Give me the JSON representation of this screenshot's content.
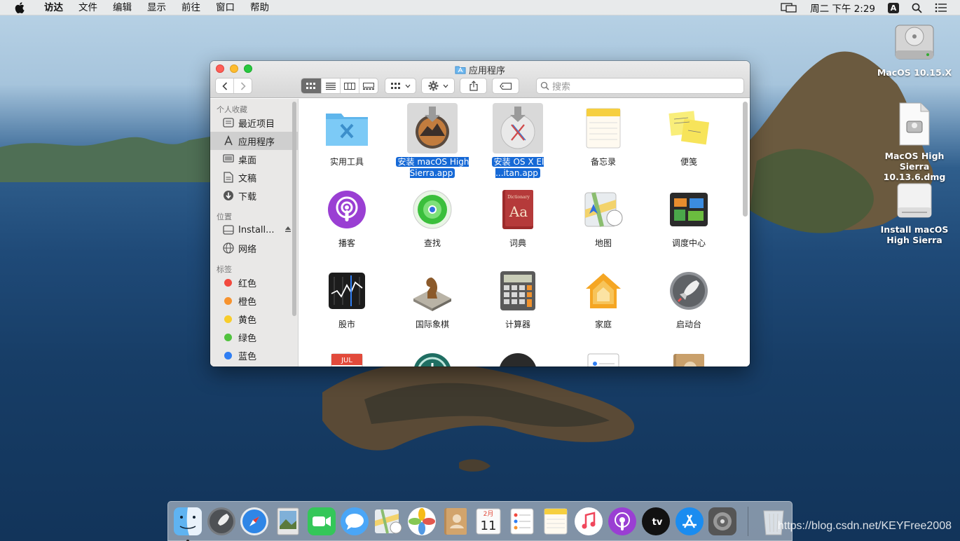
{
  "menubar": {
    "items": [
      "访达",
      "文件",
      "编辑",
      "显示",
      "前往",
      "窗口",
      "帮助"
    ],
    "clock": "周二 下午 2:29",
    "ime": "A"
  },
  "desktop_icons": [
    {
      "label": "MacOS 10.15.X",
      "icon": "hard-drive-icon"
    },
    {
      "label": "MacOS High Sierra 10.13.6.dmg",
      "icon": "dmg-file-icon"
    },
    {
      "label": "Install macOS High Sierra",
      "icon": "external-drive-icon"
    }
  ],
  "window": {
    "title": "应用程序",
    "search_placeholder": "搜索"
  },
  "sidebar": {
    "favorites_header": "个人收藏",
    "favorites": [
      {
        "label": "最近项目",
        "icon": "recents-icon"
      },
      {
        "label": "应用程序",
        "icon": "applications-icon",
        "selected": true
      },
      {
        "label": "桌面",
        "icon": "desktop-icon"
      },
      {
        "label": "文稿",
        "icon": "documents-icon"
      },
      {
        "label": "下载",
        "icon": "downloads-icon"
      }
    ],
    "locations_header": "位置",
    "locations": [
      {
        "label": "Install...",
        "icon": "drive-icon",
        "eject": true
      },
      {
        "label": "网络",
        "icon": "network-icon"
      }
    ],
    "tags_header": "标签",
    "tags": [
      {
        "label": "红色",
        "color": "#f2493e"
      },
      {
        "label": "橙色",
        "color": "#f7932f"
      },
      {
        "label": "黄色",
        "color": "#f8cd2c"
      },
      {
        "label": "绿色",
        "color": "#52c33f"
      },
      {
        "label": "蓝色",
        "color": "#2f7ef3"
      }
    ]
  },
  "apps": [
    {
      "label": "实用工具",
      "icon": "utilities-folder-icon"
    },
    {
      "label": "安装 macOS High Sierra.app",
      "icon": "install-high-sierra-icon",
      "selected": true
    },
    {
      "label": "安装 OS X El ...itan.app",
      "icon": "install-el-capitan-icon",
      "selected": true
    },
    {
      "label": "备忘录",
      "icon": "notes-icon"
    },
    {
      "label": "便笺",
      "icon": "stickies-icon"
    },
    {
      "label": "播客",
      "icon": "podcasts-icon"
    },
    {
      "label": "查找",
      "icon": "find-my-icon"
    },
    {
      "label": "词典",
      "icon": "dictionary-icon"
    },
    {
      "label": "地图",
      "icon": "maps-icon"
    },
    {
      "label": "调度中心",
      "icon": "mission-control-icon"
    },
    {
      "label": "股市",
      "icon": "stocks-icon"
    },
    {
      "label": "国际象棋",
      "icon": "chess-icon"
    },
    {
      "label": "计算器",
      "icon": "calculator-icon"
    },
    {
      "label": "家庭",
      "icon": "home-icon"
    },
    {
      "label": "启动台",
      "icon": "launchpad-icon"
    }
  ],
  "partial_icons": [
    "calendar-icon",
    "time-machine-icon",
    "unknown-dark-icon",
    "reminders-icon",
    "contacts-icon"
  ],
  "dictionary_text": "Dictionary",
  "dictionary_glyph": "Aa",
  "calendar_month": "JUL",
  "dock": {
    "items": [
      "finder-icon",
      "launchpad-icon",
      "safari-icon",
      "preview-icon",
      "facetime-icon",
      "messages-icon",
      "maps-icon",
      "photos-icon",
      "contacts-icon",
      "calendar-icon",
      "reminders-icon",
      "notes-icon",
      "music-icon",
      "podcasts-icon",
      "tv-icon",
      "app-store-icon",
      "system-preferences-icon",
      "trash-icon"
    ],
    "calendar_month": "2月",
    "calendar_day": "11",
    "tv_label": "tv"
  },
  "watermark": "https://blog.csdn.net/KEYFree2008"
}
